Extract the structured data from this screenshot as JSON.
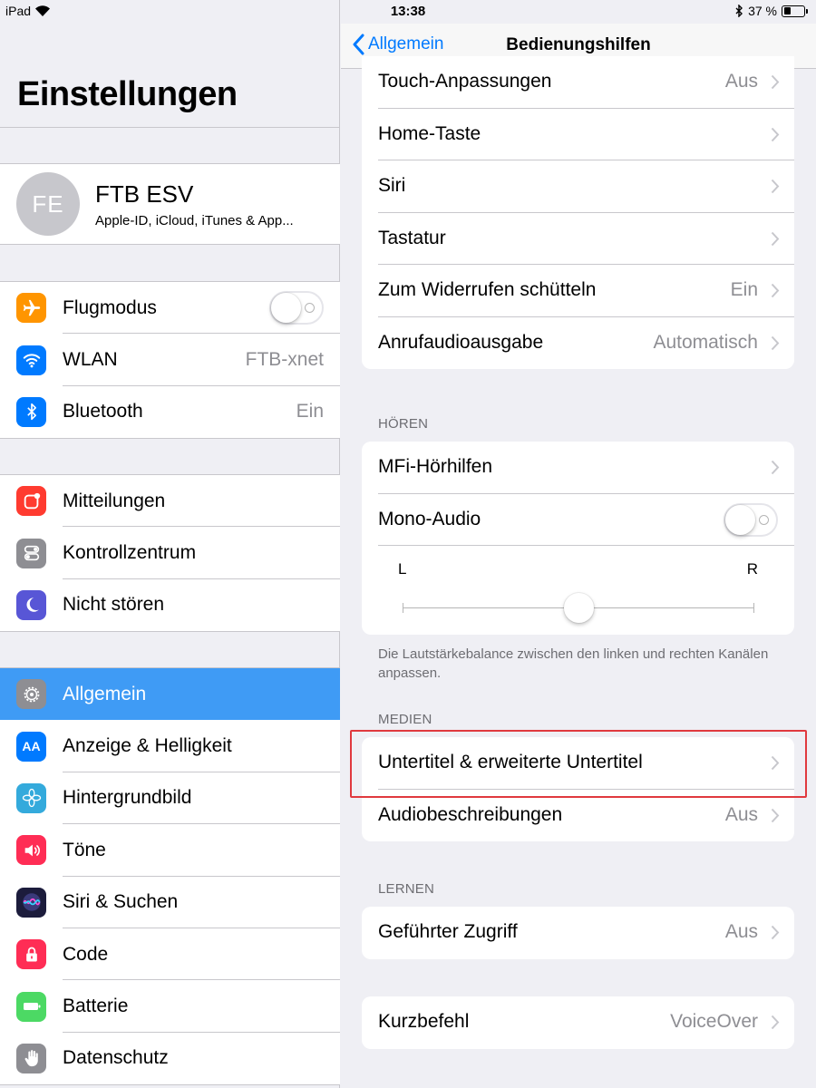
{
  "status_bar": {
    "device": "iPad",
    "time": "13:38",
    "battery_percent": "37 %",
    "battery_level": 0.37
  },
  "master": {
    "title": "Einstellungen",
    "profile": {
      "initials": "FE",
      "name": "FTB ESV",
      "subtitle": "Apple-ID, iCloud, iTunes & App..."
    },
    "group1": [
      {
        "label": "Flugmodus",
        "icon": "airplane-icon",
        "color": "#ff9500",
        "toggle": false
      },
      {
        "label": "WLAN",
        "icon": "wifi-icon",
        "color": "#007aff",
        "value": "FTB-xnet"
      },
      {
        "label": "Bluetooth",
        "icon": "bluetooth-icon",
        "color": "#007aff",
        "value": "Ein"
      }
    ],
    "group2": [
      {
        "label": "Mitteilungen",
        "icon": "notifications-icon",
        "color": "#ff3b30"
      },
      {
        "label": "Kontrollzentrum",
        "icon": "control-center-icon",
        "color": "#8e8e93"
      },
      {
        "label": "Nicht stören",
        "icon": "moon-icon",
        "color": "#5856d6"
      }
    ],
    "group3": [
      {
        "label": "Allgemein",
        "icon": "gear-icon",
        "color": "#8e8e93",
        "selected": true
      },
      {
        "label": "Anzeige & Helligkeit",
        "icon": "display-icon",
        "color": "#007aff"
      },
      {
        "label": "Hintergrundbild",
        "icon": "wallpaper-icon",
        "color": "#34aadc"
      },
      {
        "label": "Töne",
        "icon": "sound-icon",
        "color": "#ff2d55"
      },
      {
        "label": "Siri & Suchen",
        "icon": "siri-icon",
        "color": "#1c1c3c"
      },
      {
        "label": "Code",
        "icon": "lock-icon",
        "color": "#ff2d55"
      },
      {
        "label": "Batterie",
        "icon": "battery-icon",
        "color": "#4cd964"
      },
      {
        "label": "Datenschutz",
        "icon": "hand-icon",
        "color": "#8e8e93"
      }
    ]
  },
  "detail": {
    "back_label": "Allgemein",
    "title": "Bedienungshilfen",
    "rows_top": [
      {
        "label": "Touch-Anpassungen",
        "value": "Aus"
      },
      {
        "label": "Home-Taste",
        "value": ""
      },
      {
        "label": "Siri",
        "value": ""
      },
      {
        "label": "Tastatur",
        "value": ""
      },
      {
        "label": "Zum Widerrufen schütteln",
        "value": "Ein"
      },
      {
        "label": "Anrufaudioausgabe",
        "value": "Automatisch"
      }
    ],
    "hoeren": {
      "header": "HÖREN",
      "mfi": "MFi-Hörhilfen",
      "mono": "Mono-Audio",
      "mono_on": false,
      "balance_left": "L",
      "balance_right": "R",
      "balance_value": 0.5,
      "footnote": "Die Lautstärkebalance zwischen den linken und rechten Kanälen anpassen."
    },
    "medien": {
      "header": "MEDIEN",
      "rows": [
        {
          "label": "Untertitel & erweiterte Untertitel",
          "value": ""
        },
        {
          "label": "Audiobeschreibungen",
          "value": "Aus"
        }
      ]
    },
    "lernen": {
      "header": "LERNEN",
      "rows": [
        {
          "label": "Geführter Zugriff",
          "value": "Aus"
        }
      ]
    },
    "shortcut": {
      "label": "Kurzbefehl",
      "value": "VoiceOver"
    }
  }
}
